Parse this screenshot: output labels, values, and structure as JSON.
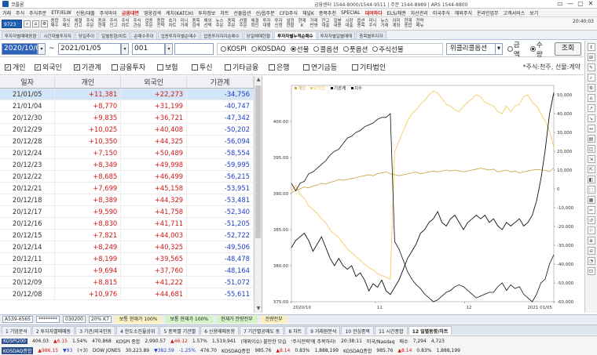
{
  "titlebar": {
    "title": "코플론",
    "info": "금융센터 1544-8000/1544-9511 | 주문 1544-8989 | ARS 1544-8800",
    "buttons": [
      "▭",
      "—",
      "▢",
      "✕"
    ]
  },
  "menubar": {
    "items": [
      "거래",
      "주식",
      "주식주문",
      "ETF/ELW",
      "신용/대출",
      "주식마이",
      "금융대면",
      "영웅검색",
      "케치(KATCH)",
      "투자정보",
      "차트",
      "선물옵션",
      "선/옵주문",
      "CFD주식",
      "채널K",
      "종목추천",
      "SPECIAL",
      "대여하다",
      "ELS/채권",
      "자산관리",
      "미국주식",
      "해외주식",
      "온라인업무",
      "고객서비스",
      "보기"
    ],
    "highlight": [
      "금융대면",
      "대여하다"
    ]
  },
  "toolbar": {
    "screen_number": "9723",
    "items": [
      "종합\n매수",
      "주식\n매도",
      "체결\n잔고",
      "주식\n주문",
      "증권\n현재",
      "주식\n잔고",
      "주식\n차트",
      "주식\n관심",
      "업종\n주문",
      "종합\n전략",
      "호가\n차트",
      "미니\n거래",
      "종목\n검색",
      "해외\n선택",
      "뉴스\n주문",
      "종목\n주문",
      "선물\n주문",
      "체결\n확인",
      "투자\n대행",
      "투자\n신청",
      "설정\n현황",
      "현재\nK",
      "거래\n반영",
      "잔고\n대출",
      "일봉\n내용",
      "시장\n대출",
      "옵션\n종목",
      "미니\n주식",
      "뉴스\n거래",
      "이미\n계좌",
      "현재\n종합",
      "전략\n메뉴"
    ],
    "time": "20:40:03"
  },
  "tabs": {
    "items": [
      "투자자별매매동향",
      "시간대별투자자",
      "당일추이",
      "일별동향/차트",
      "순매수추이",
      "업종투자자별순매수",
      "업종투자자자순매수",
      "당일매매현황",
      "투자자별누적순매수",
      "투자자별일별매매",
      "종목별투자자"
    ],
    "active": 8
  },
  "controls": {
    "start_date": "2020/10/01",
    "end_date": "2021/01/05",
    "code": "001",
    "market_options": [
      {
        "label": "KOSPI",
        "on": false
      },
      {
        "label": "KOSDAQ",
        "on": false
      },
      {
        "label": "선물",
        "on": true
      },
      {
        "label": "콜옵션",
        "on": false
      },
      {
        "label": "풋옵션",
        "on": false
      },
      {
        "label": "주식선물",
        "on": false
      }
    ],
    "weekly_select": "위클리콜옵션",
    "unit_options": [
      {
        "label": "금액",
        "on": false
      },
      {
        "label": "수량",
        "on": true
      }
    ],
    "query_button": "조회"
  },
  "investors": {
    "items": [
      {
        "label": "개인",
        "checked": true
      },
      {
        "label": "외국인",
        "checked": true
      },
      {
        "label": "기관계",
        "checked": true
      },
      {
        "label": "금융투자",
        "checked": false
      },
      {
        "label": "보험",
        "checked": false
      },
      {
        "label": "투신",
        "checked": false
      },
      {
        "label": "기타금융",
        "checked": false
      },
      {
        "label": "은행",
        "checked": false
      },
      {
        "label": "연기금등",
        "checked": false
      },
      {
        "label": "기타법인",
        "checked": false
      }
    ],
    "note": "*주식:천주, 선물:계약"
  },
  "table": {
    "headers": [
      "일자",
      "개인",
      "외국인",
      "기관계"
    ],
    "rows": [
      [
        "21/01/05",
        "+11,381",
        "+22,273",
        "-34,756"
      ],
      [
        "21/01/04",
        "+8,770",
        "+31,199",
        "-40,747"
      ],
      [
        "20/12/30",
        "+9,835",
        "+36,721",
        "-47,342"
      ],
      [
        "20/12/29",
        "+10,025",
        "+40,408",
        "-50,202"
      ],
      [
        "20/12/28",
        "+10,350",
        "+44,325",
        "-56,094"
      ],
      [
        "20/12/24",
        "+7,150",
        "+50,489",
        "-58,554"
      ],
      [
        "20/12/23",
        "+8,349",
        "+49,998",
        "-59,995"
      ],
      [
        "20/12/22",
        "+8,685",
        "+46,499",
        "-56,215"
      ],
      [
        "20/12/21",
        "+7,699",
        "+45,158",
        "-53,951"
      ],
      [
        "20/12/18",
        "+8,389",
        "+44,329",
        "-53,481"
      ],
      [
        "20/12/17",
        "+9,590",
        "+41,758",
        "-52,340"
      ],
      [
        "20/12/16",
        "+8,830",
        "+41,711",
        "-51,205"
      ],
      [
        "20/12/15",
        "+7,821",
        "+44,003",
        "-52,722"
      ],
      [
        "20/12/14",
        "+8,249",
        "+40,325",
        "-49,506"
      ],
      [
        "20/12/11",
        "+8,199",
        "+39,565",
        "-48,478"
      ],
      [
        "20/12/10",
        "+9,694",
        "+37,760",
        "-48,164"
      ],
      [
        "20/12/09",
        "+8,815",
        "+41,222",
        "-51,072"
      ],
      [
        "20/12/08",
        "+10,976",
        "+44,681",
        "-55,611"
      ]
    ],
    "selected_row": 0
  },
  "chart_data": {
    "type": "line",
    "legend": [
      "개인",
      "외국인",
      "기관계",
      "지수"
    ],
    "legend_placement": "top-left",
    "colors": {
      "개인": "#c8a13a",
      "외국인": "#f2c84a",
      "기관계": "#111111",
      "지수": "#111111"
    },
    "x_ticks": [
      "2020/10",
      "11",
      "12",
      "2021 01/05"
    ],
    "left_axis": {
      "label": "지수",
      "ylim": [
        375,
        405
      ],
      "ticks": [
        375,
        380,
        385,
        390,
        395,
        400
      ]
    },
    "right_axis": {
      "label": "순매수",
      "ylim": [
        -60000,
        55000
      ],
      "ticks": [
        50000,
        40000,
        30000,
        20000,
        10000,
        0,
        -10000,
        -20000,
        -30000,
        -40000,
        -50000,
        -60000
      ]
    },
    "series": [
      {
        "name": "외국인",
        "axis": "right",
        "values": [
          -1000,
          2000,
          -3000,
          -5000,
          -9000,
          -11000,
          -13000,
          -16000,
          -18000,
          -22000,
          -24000,
          -26000,
          -29000,
          -32000,
          -34000,
          -36000,
          -38000,
          -40000,
          -42000,
          -43000,
          -45000,
          -46000,
          -47000,
          -48000,
          20000,
          25000,
          31000,
          36000,
          40000,
          42000,
          45000,
          47000,
          50000,
          52000,
          51000,
          48000,
          45000,
          44000,
          42000,
          41000,
          44000,
          46000,
          48000,
          50000,
          49000,
          46000,
          45000,
          44000,
          41000,
          40000,
          44000,
          41000,
          44000,
          45000,
          49000,
          50000,
          46000,
          44000,
          40000,
          36000,
          31000,
          22000
        ]
      },
      {
        "name": "개인",
        "axis": "right",
        "values": [
          -2000,
          -1000,
          0,
          1000,
          500,
          1500,
          2000,
          3000,
          2500,
          3500,
          4000,
          5000,
          4500,
          5000,
          5500,
          6000,
          6500,
          7000,
          7500,
          7000,
          8000,
          8500,
          9000,
          8000,
          7500,
          7000,
          7500,
          8000,
          8500,
          9000,
          8000,
          8500,
          9000,
          9500,
          9000,
          9500,
          10000,
          9500,
          10000,
          9500,
          9000,
          9500,
          10000,
          10500,
          11000,
          10500,
          10000,
          10500,
          9000,
          9500,
          10000,
          9000,
          9500,
          8500,
          9000,
          9500,
          10000,
          10300,
          10000,
          9900,
          9200,
          11000
        ]
      },
      {
        "name": "기관계",
        "axis": "right",
        "values": [
          3000,
          -1000,
          3000,
          4000,
          8000,
          9000,
          11000,
          13000,
          15000,
          18000,
          20000,
          21000,
          24000,
          27000,
          28000,
          30000,
          31000,
          33000,
          34000,
          35000,
          37000,
          38000,
          38000,
          40000,
          -28000,
          -32000,
          -38000,
          -44000,
          -48000,
          -51000,
          -53000,
          -56000,
          -58000,
          -60000,
          -59000,
          -57000,
          -55000,
          -54000,
          -52000,
          -51000,
          -52000,
          -54000,
          -56000,
          -58000,
          -57000,
          -56000,
          -55000,
          -55000,
          -52000,
          -50000,
          -54000,
          -51000,
          -53000,
          -52000,
          -56000,
          -58000,
          -60000,
          -56000,
          -50000,
          -48000,
          -40000,
          -35000
        ]
      },
      {
        "name": "지수",
        "axis": "left",
        "values": [
          382.5,
          383.5,
          384.0,
          384.5,
          383.5,
          382.0,
          383.0,
          384.0,
          382.5,
          381.0,
          380.0,
          381.0,
          380.0,
          379.5,
          380.0,
          378.5,
          379.0,
          378.0,
          376.5,
          377.5,
          377.0,
          378.0,
          376.5,
          376.0,
          377.0,
          378.0,
          379.5,
          381.0,
          382.0,
          383.0,
          384.5,
          385.0,
          386.0,
          386.5,
          387.5,
          386.0,
          385.5,
          386.5,
          387.0,
          386.0,
          385.0,
          386.0,
          386.5,
          387.0,
          386.5,
          387.0,
          386.0,
          386.5,
          385.5,
          385.0,
          386.0,
          385.5,
          386.0,
          386.5,
          385.5,
          386.0,
          387.0,
          389.0,
          392.0,
          396.0,
          401.0,
          404.0
        ]
      }
    ]
  },
  "rightbar": {
    "icons": [
      "↕",
      "⊞",
      "✎",
      "⌕",
      "⚙",
      "⌂",
      "↗",
      "↘",
      "↔",
      "▤",
      "◫",
      "⇲",
      "⇱",
      "◧",
      "⬚",
      "▦",
      "✂",
      "↺",
      "⚐",
      "⊕",
      "⊖",
      "◔",
      "⊡"
    ]
  },
  "statusA": {
    "code": "A539-6565",
    "account": "********",
    "order": "030200",
    "unit": "20% K7",
    "s1": "보통 현재가 100%",
    "s2": "보통 현재가 100%",
    "s3": "현재가 잔량전부",
    "s4": "잔량전부"
  },
  "statusB": {
    "items": [
      "1 기업분석",
      "2 투자자별매매동",
      "3 기관/외국인동",
      "4 한도소진율상위",
      "5 종목별 기관별",
      "6 신용매매동향",
      "7 기간별공매도 동",
      "8 차트",
      "9 거래원분석",
      "10 관심종목",
      "11 시간종합",
      "12 일별동향/차트"
    ],
    "active": 11
  },
  "ticker": {
    "line1": [
      "KOSPI200",
      "406.03",
      "▲6.15",
      "1.54%",
      "470,868",
      "KOSPI 종합",
      "2,990.57",
      "▲46.12",
      "1.57%",
      "1,519,941",
      "(해외이슈) 불안한 모습",
      "'주식전략'에 주목하라!",
      "20:38:11",
      "미국/Nasdaq",
      "매수",
      "7,294",
      "4,723"
    ],
    "line2": [
      "KOSDAQ종합",
      "▲986.15",
      "▼93",
      "(+3)",
      "DOW JONES",
      "30,223.89",
      "▼382.59",
      "-1.25%",
      "476.70",
      "KOSDAQ종합",
      "985.76",
      "▲8.14",
      "0.83%",
      "1,888,199",
      "KOSDAQ종합",
      "985.76",
      "▲8.14",
      "0.83%",
      "1,888,199"
    ]
  }
}
